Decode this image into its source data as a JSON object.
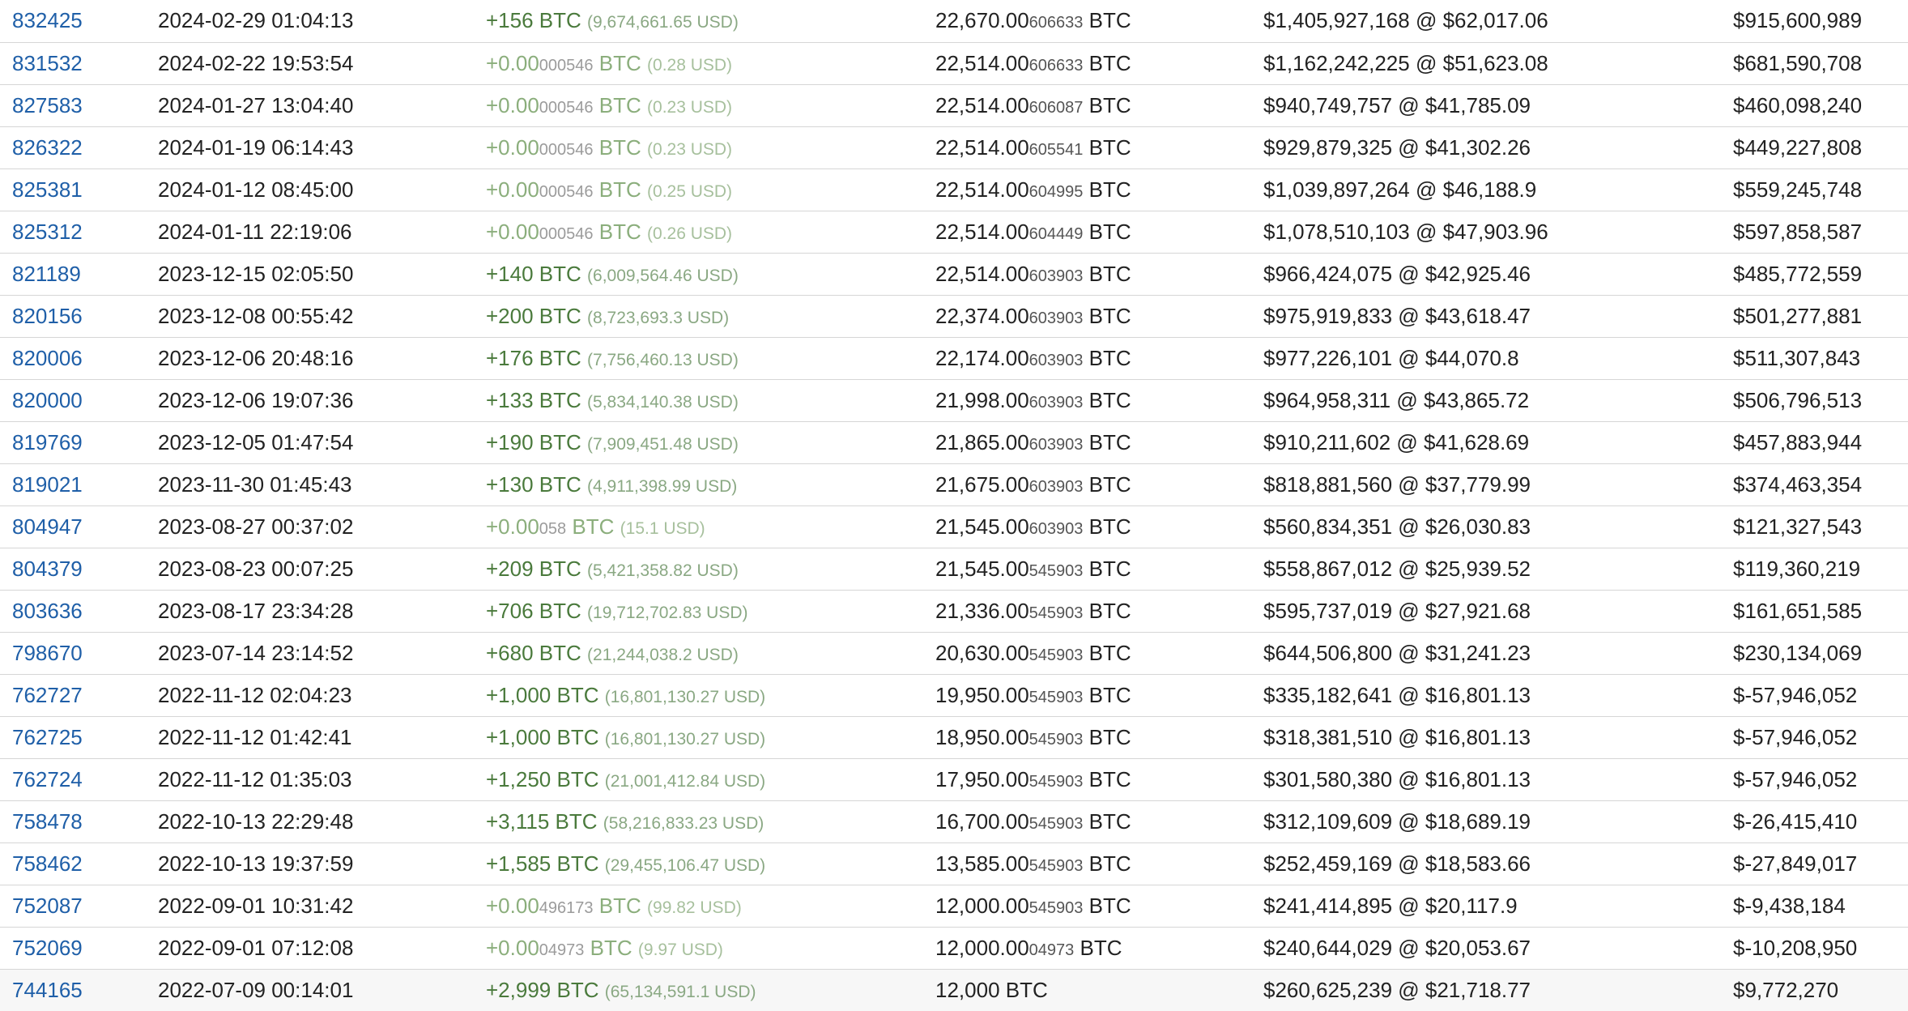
{
  "columns": [
    "block",
    "time",
    "amount",
    "balance",
    "balance_value",
    "profit"
  ],
  "colors": {
    "link": "#1f5fa8",
    "amount_positive": "#4a7a3c",
    "amount_tiny": "#8bae7c",
    "row_divider": "#d6d6d6"
  },
  "rows": [
    {
      "block": "832425",
      "time": "2024-02-29 01:04:13",
      "amt_main": "+156",
      "amt_small": "",
      "amt_unit": " BTC",
      "amt_usd": "(9,674,661.65 USD)",
      "tiny": false,
      "bal_main": "22,670.00",
      "bal_small": "606633",
      "bal_unit": " BTC",
      "value": "$1,405,927,168 @ $62,017.06",
      "profit": "$915,600,989"
    },
    {
      "block": "831532",
      "time": "2024-02-22 19:53:54",
      "amt_main": "+0.00",
      "amt_small": "000546",
      "amt_unit": " BTC",
      "amt_usd": "(0.28 USD)",
      "tiny": true,
      "bal_main": "22,514.00",
      "bal_small": "606633",
      "bal_unit": " BTC",
      "value": "$1,162,242,225 @ $51,623.08",
      "profit": "$681,590,708"
    },
    {
      "block": "827583",
      "time": "2024-01-27 13:04:40",
      "amt_main": "+0.00",
      "amt_small": "000546",
      "amt_unit": " BTC",
      "amt_usd": "(0.23 USD)",
      "tiny": true,
      "bal_main": "22,514.00",
      "bal_small": "606087",
      "bal_unit": " BTC",
      "value": "$940,749,757 @ $41,785.09",
      "profit": "$460,098,240"
    },
    {
      "block": "826322",
      "time": "2024-01-19 06:14:43",
      "amt_main": "+0.00",
      "amt_small": "000546",
      "amt_unit": " BTC",
      "amt_usd": "(0.23 USD)",
      "tiny": true,
      "bal_main": "22,514.00",
      "bal_small": "605541",
      "bal_unit": " BTC",
      "value": "$929,879,325 @ $41,302.26",
      "profit": "$449,227,808"
    },
    {
      "block": "825381",
      "time": "2024-01-12 08:45:00",
      "amt_main": "+0.00",
      "amt_small": "000546",
      "amt_unit": " BTC",
      "amt_usd": "(0.25 USD)",
      "tiny": true,
      "bal_main": "22,514.00",
      "bal_small": "604995",
      "bal_unit": " BTC",
      "value": "$1,039,897,264 @ $46,188.9",
      "profit": "$559,245,748"
    },
    {
      "block": "825312",
      "time": "2024-01-11 22:19:06",
      "amt_main": "+0.00",
      "amt_small": "000546",
      "amt_unit": " BTC",
      "amt_usd": "(0.26 USD)",
      "tiny": true,
      "bal_main": "22,514.00",
      "bal_small": "604449",
      "bal_unit": " BTC",
      "value": "$1,078,510,103 @ $47,903.96",
      "profit": "$597,858,587"
    },
    {
      "block": "821189",
      "time": "2023-12-15 02:05:50",
      "amt_main": "+140",
      "amt_small": "",
      "amt_unit": " BTC",
      "amt_usd": "(6,009,564.46 USD)",
      "tiny": false,
      "bal_main": "22,514.00",
      "bal_small": "603903",
      "bal_unit": " BTC",
      "value": "$966,424,075 @ $42,925.46",
      "profit": "$485,772,559"
    },
    {
      "block": "820156",
      "time": "2023-12-08 00:55:42",
      "amt_main": "+200",
      "amt_small": "",
      "amt_unit": " BTC",
      "amt_usd": "(8,723,693.3 USD)",
      "tiny": false,
      "bal_main": "22,374.00",
      "bal_small": "603903",
      "bal_unit": " BTC",
      "value": "$975,919,833 @ $43,618.47",
      "profit": "$501,277,881"
    },
    {
      "block": "820006",
      "time": "2023-12-06 20:48:16",
      "amt_main": "+176",
      "amt_small": "",
      "amt_unit": " BTC",
      "amt_usd": "(7,756,460.13 USD)",
      "tiny": false,
      "bal_main": "22,174.00",
      "bal_small": "603903",
      "bal_unit": " BTC",
      "value": "$977,226,101 @ $44,070.8",
      "profit": "$511,307,843"
    },
    {
      "block": "820000",
      "time": "2023-12-06 19:07:36",
      "amt_main": "+133",
      "amt_small": "",
      "amt_unit": " BTC",
      "amt_usd": "(5,834,140.38 USD)",
      "tiny": false,
      "bal_main": "21,998.00",
      "bal_small": "603903",
      "bal_unit": " BTC",
      "value": "$964,958,311 @ $43,865.72",
      "profit": "$506,796,513"
    },
    {
      "block": "819769",
      "time": "2023-12-05 01:47:54",
      "amt_main": "+190",
      "amt_small": "",
      "amt_unit": " BTC",
      "amt_usd": "(7,909,451.48 USD)",
      "tiny": false,
      "bal_main": "21,865.00",
      "bal_small": "603903",
      "bal_unit": " BTC",
      "value": "$910,211,602 @ $41,628.69",
      "profit": "$457,883,944"
    },
    {
      "block": "819021",
      "time": "2023-11-30 01:45:43",
      "amt_main": "+130",
      "amt_small": "",
      "amt_unit": " BTC",
      "amt_usd": "(4,911,398.99 USD)",
      "tiny": false,
      "bal_main": "21,675.00",
      "bal_small": "603903",
      "bal_unit": " BTC",
      "value": "$818,881,560 @ $37,779.99",
      "profit": "$374,463,354"
    },
    {
      "block": "804947",
      "time": "2023-08-27 00:37:02",
      "amt_main": "+0.00",
      "amt_small": "058",
      "amt_unit": " BTC",
      "amt_usd": "(15.1 USD)",
      "tiny": true,
      "bal_main": "21,545.00",
      "bal_small": "603903",
      "bal_unit": " BTC",
      "value": "$560,834,351 @ $26,030.83",
      "profit": "$121,327,543"
    },
    {
      "block": "804379",
      "time": "2023-08-23 00:07:25",
      "amt_main": "+209",
      "amt_small": "",
      "amt_unit": " BTC",
      "amt_usd": "(5,421,358.82 USD)",
      "tiny": false,
      "bal_main": "21,545.00",
      "bal_small": "545903",
      "bal_unit": " BTC",
      "value": "$558,867,012 @ $25,939.52",
      "profit": "$119,360,219"
    },
    {
      "block": "803636",
      "time": "2023-08-17 23:34:28",
      "amt_main": "+706",
      "amt_small": "",
      "amt_unit": " BTC",
      "amt_usd": "(19,712,702.83 USD)",
      "tiny": false,
      "bal_main": "21,336.00",
      "bal_small": "545903",
      "bal_unit": " BTC",
      "value": "$595,737,019 @ $27,921.68",
      "profit": "$161,651,585"
    },
    {
      "block": "798670",
      "time": "2023-07-14 23:14:52",
      "amt_main": "+680",
      "amt_small": "",
      "amt_unit": " BTC",
      "amt_usd": "(21,244,038.2 USD)",
      "tiny": false,
      "bal_main": "20,630.00",
      "bal_small": "545903",
      "bal_unit": " BTC",
      "value": "$644,506,800 @ $31,241.23",
      "profit": "$230,134,069"
    },
    {
      "block": "762727",
      "time": "2022-11-12 02:04:23",
      "amt_main": "+1,000",
      "amt_small": "",
      "amt_unit": " BTC",
      "amt_usd": "(16,801,130.27 USD)",
      "tiny": false,
      "bal_main": "19,950.00",
      "bal_small": "545903",
      "bal_unit": " BTC",
      "value": "$335,182,641 @ $16,801.13",
      "profit": "$-57,946,052"
    },
    {
      "block": "762725",
      "time": "2022-11-12 01:42:41",
      "amt_main": "+1,000",
      "amt_small": "",
      "amt_unit": " BTC",
      "amt_usd": "(16,801,130.27 USD)",
      "tiny": false,
      "bal_main": "18,950.00",
      "bal_small": "545903",
      "bal_unit": " BTC",
      "value": "$318,381,510 @ $16,801.13",
      "profit": "$-57,946,052"
    },
    {
      "block": "762724",
      "time": "2022-11-12 01:35:03",
      "amt_main": "+1,250",
      "amt_small": "",
      "amt_unit": " BTC",
      "amt_usd": "(21,001,412.84 USD)",
      "tiny": false,
      "bal_main": "17,950.00",
      "bal_small": "545903",
      "bal_unit": " BTC",
      "value": "$301,580,380 @ $16,801.13",
      "profit": "$-57,946,052"
    },
    {
      "block": "758478",
      "time": "2022-10-13 22:29:48",
      "amt_main": "+3,115",
      "amt_small": "",
      "amt_unit": " BTC",
      "amt_usd": "(58,216,833.23 USD)",
      "tiny": false,
      "bal_main": "16,700.00",
      "bal_small": "545903",
      "bal_unit": " BTC",
      "value": "$312,109,609 @ $18,689.19",
      "profit": "$-26,415,410"
    },
    {
      "block": "758462",
      "time": "2022-10-13 19:37:59",
      "amt_main": "+1,585",
      "amt_small": "",
      "amt_unit": " BTC",
      "amt_usd": "(29,455,106.47 USD)",
      "tiny": false,
      "bal_main": "13,585.00",
      "bal_small": "545903",
      "bal_unit": " BTC",
      "value": "$252,459,169 @ $18,583.66",
      "profit": "$-27,849,017"
    },
    {
      "block": "752087",
      "time": "2022-09-01 10:31:42",
      "amt_main": "+0.00",
      "amt_small": "496173",
      "amt_unit": " BTC",
      "amt_usd": "(99.82 USD)",
      "tiny": true,
      "bal_main": "12,000.00",
      "bal_small": "545903",
      "bal_unit": " BTC",
      "value": "$241,414,895 @ $20,117.9",
      "profit": "$-9,438,184"
    },
    {
      "block": "752069",
      "time": "2022-09-01 07:12:08",
      "amt_main": "+0.00",
      "amt_small": "04973",
      "amt_unit": " BTC",
      "amt_usd": "(9.97 USD)",
      "tiny": true,
      "bal_main": "12,000.00",
      "bal_small": "04973",
      "bal_unit": " BTC",
      "value": "$240,644,029 @ $20,053.67",
      "profit": "$-10,208,950"
    },
    {
      "block": "744165",
      "time": "2022-07-09 00:14:01",
      "amt_main": "+2,999",
      "amt_small": "",
      "amt_unit": " BTC",
      "amt_usd": "(65,134,591.1 USD)",
      "tiny": false,
      "bal_main": "12,000",
      "bal_small": "",
      "bal_unit": " BTC",
      "value": "$260,625,239 @ $21,718.77",
      "profit": "$9,772,270"
    }
  ]
}
